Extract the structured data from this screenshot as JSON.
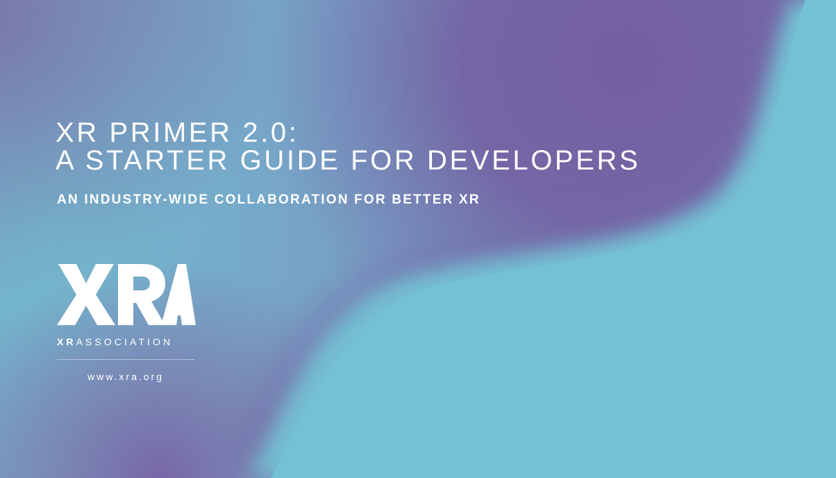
{
  "cover": {
    "title_line1": "XR PRIMER 2.0:",
    "title_line2": "A STARTER GUIDE FOR DEVELOPERS",
    "subtitle": "AN INDUSTRY-WIDE COLLABORATION FOR BETTER XR",
    "logo": {
      "mark_text": "XRA",
      "wordmark_bold": "XR",
      "wordmark_light": "ASSOCIATION"
    },
    "website": "www.xra.org"
  },
  "colors": {
    "purple": "#7563a3",
    "teal": "#74bfd4",
    "text": "#ffffff"
  }
}
